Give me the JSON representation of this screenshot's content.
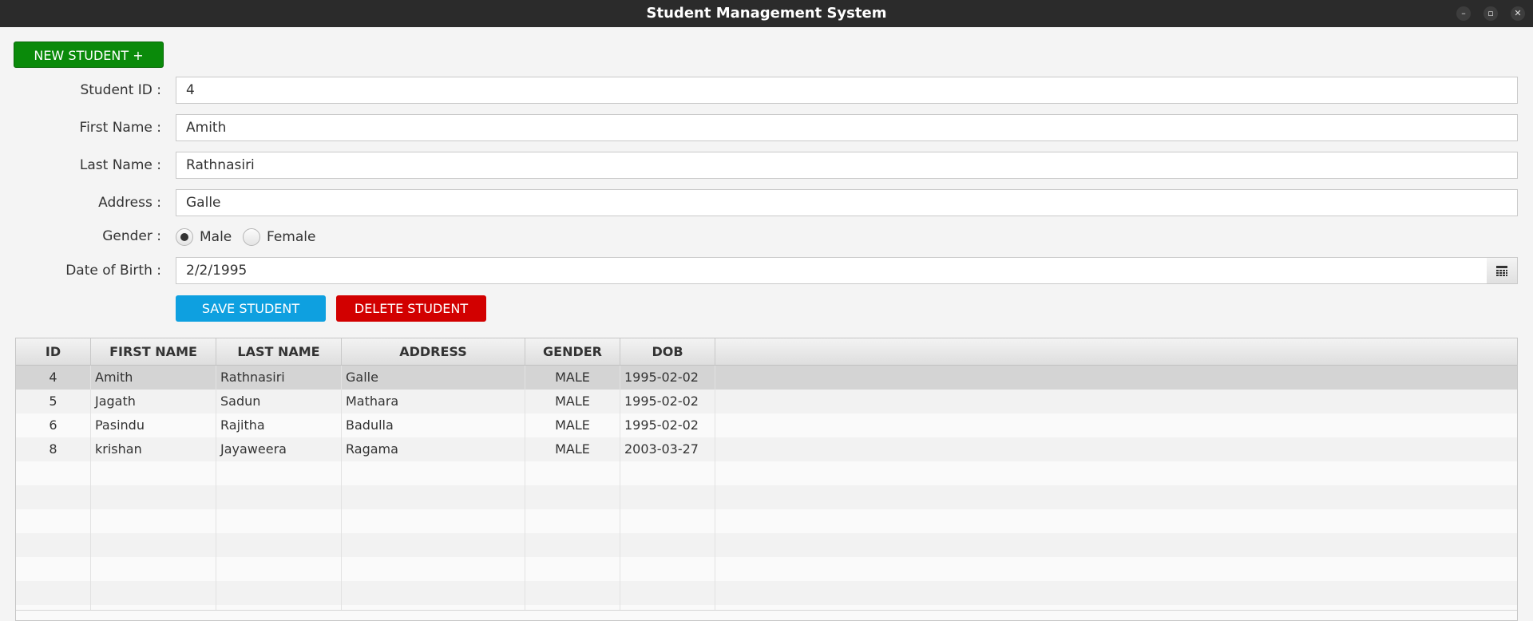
{
  "window": {
    "title": "Student Management System",
    "controls": [
      "minimize-icon",
      "restore-icon",
      "close-icon"
    ]
  },
  "toolbar": {
    "new_student_label": "NEW STUDENT +"
  },
  "form": {
    "student_id": {
      "label": "Student ID :",
      "value": "4"
    },
    "first_name": {
      "label": "First Name :",
      "value": "Amith"
    },
    "last_name": {
      "label": "Last Name :",
      "value": "Rathnasiri"
    },
    "address": {
      "label": "Address :",
      "value": "Galle"
    },
    "gender": {
      "label": "Gender :",
      "options": [
        "Male",
        "Female"
      ],
      "selected": "Male"
    },
    "dob": {
      "label": "Date of Birth :",
      "value": "2/2/1995"
    },
    "save_label": "SAVE STUDENT",
    "delete_label": "DELETE STUDENT"
  },
  "table": {
    "columns": [
      "ID",
      "FIRST NAME",
      "LAST NAME",
      "ADDRESS",
      "GENDER",
      "DOB"
    ],
    "rows": [
      [
        "4",
        "Amith",
        "Rathnasiri",
        "Galle",
        "MALE",
        "1995-02-02"
      ],
      [
        "5",
        "Jagath",
        "Sadun",
        "Mathara",
        "MALE",
        "1995-02-02"
      ],
      [
        "6",
        "Pasindu",
        "Rajitha",
        "Badulla",
        "MALE",
        "1995-02-02"
      ],
      [
        "8",
        "krishan",
        "Jayaweera",
        "Ragama",
        "MALE",
        "2003-03-27"
      ]
    ],
    "selected_row": 0
  },
  "colors": {
    "titlebar": "#2b2b2b",
    "new_button": "#0a8a0a",
    "save_button": "#0ea0e0",
    "delete_button": "#d20000",
    "selected_row": "#d4d4d4"
  }
}
